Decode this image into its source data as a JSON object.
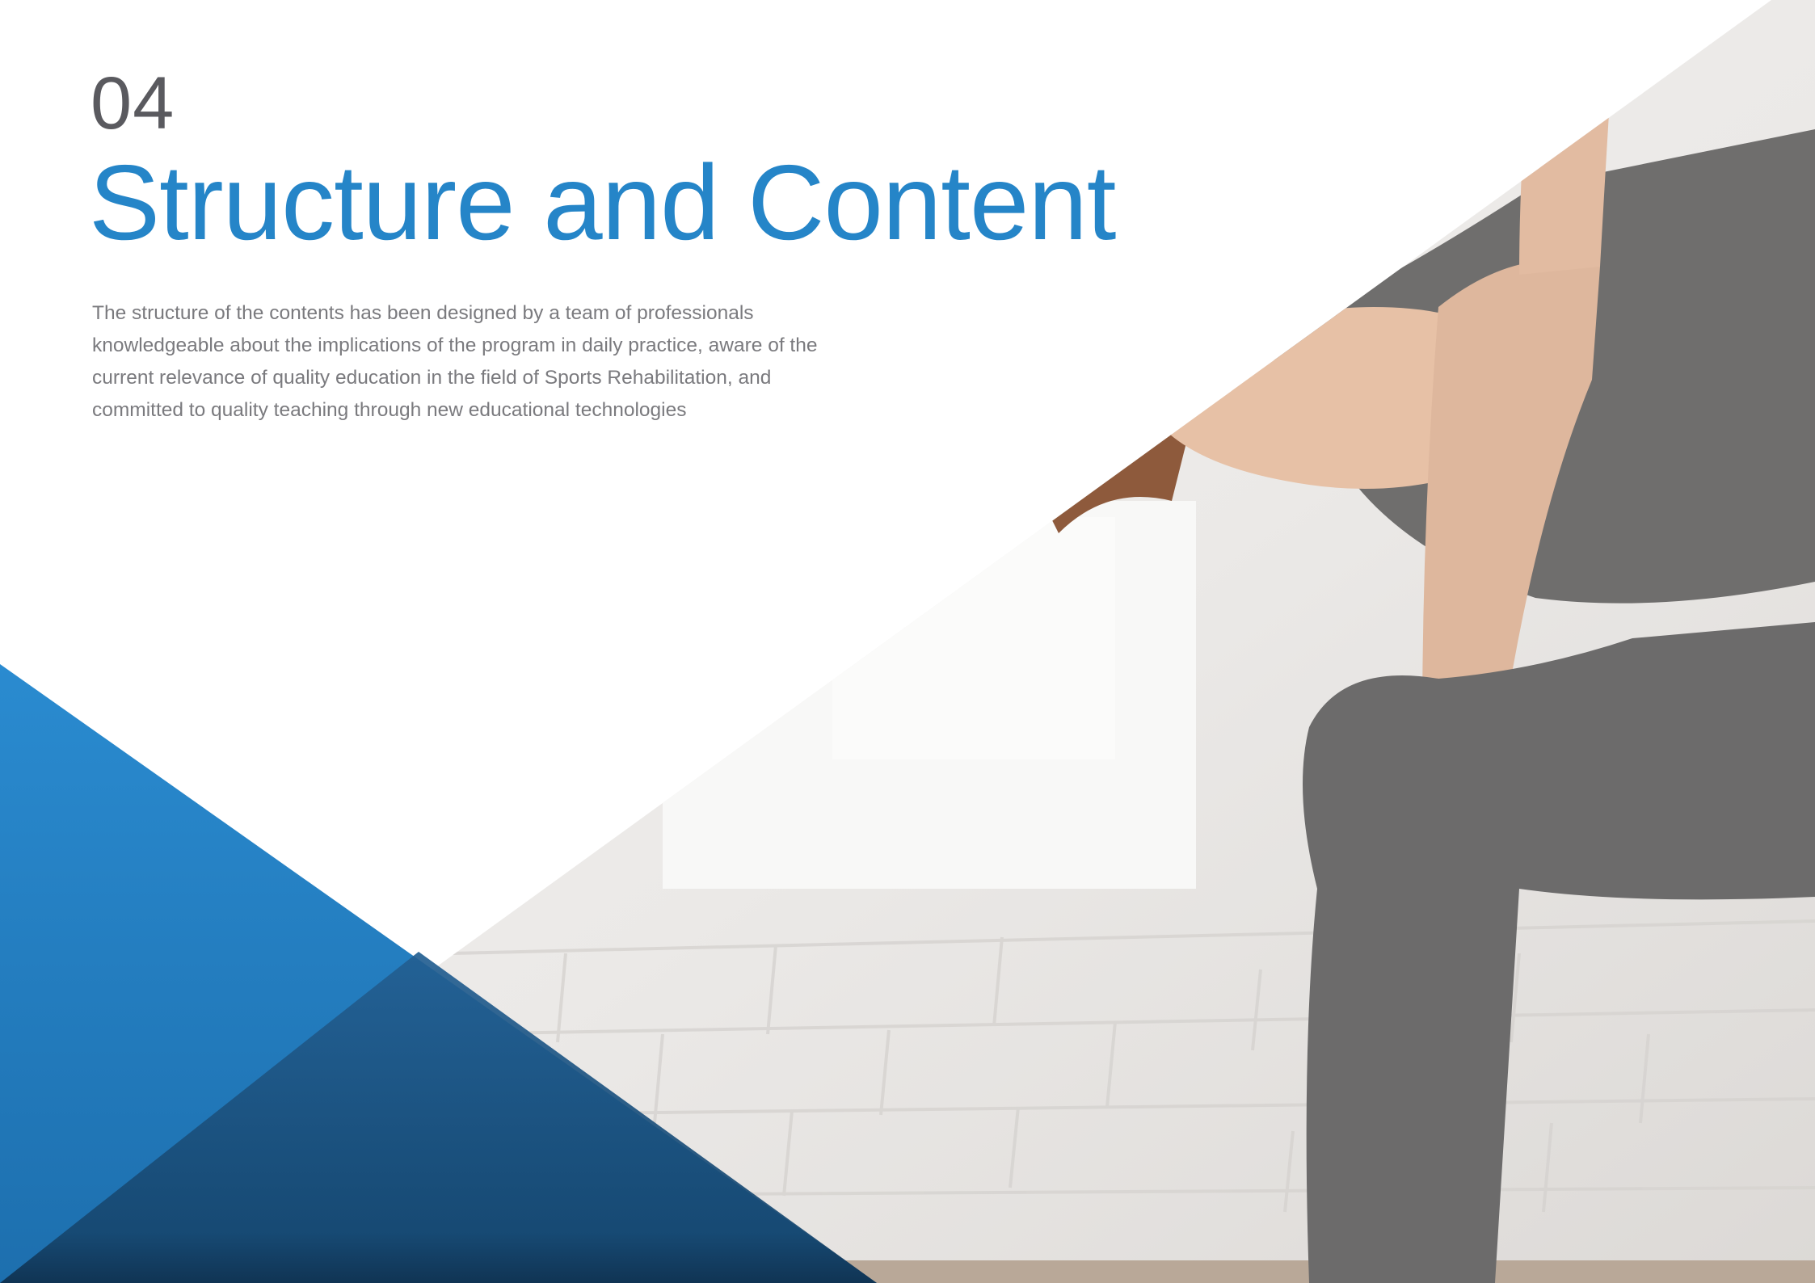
{
  "section": {
    "number": "04",
    "title": "Structure and Content",
    "intro": "The structure of the contents has been designed by a team of professionals knowledgeable about the implications of the program in daily practice, aware of the current relevance of quality education in the field of Sports Rehabilitation, and committed to quality teaching through new educational technologies"
  },
  "colors": {
    "accent": "#2585c8",
    "number_text": "#5a5a5f",
    "body_text": "#7a7a7e",
    "background": "#ffffff"
  }
}
